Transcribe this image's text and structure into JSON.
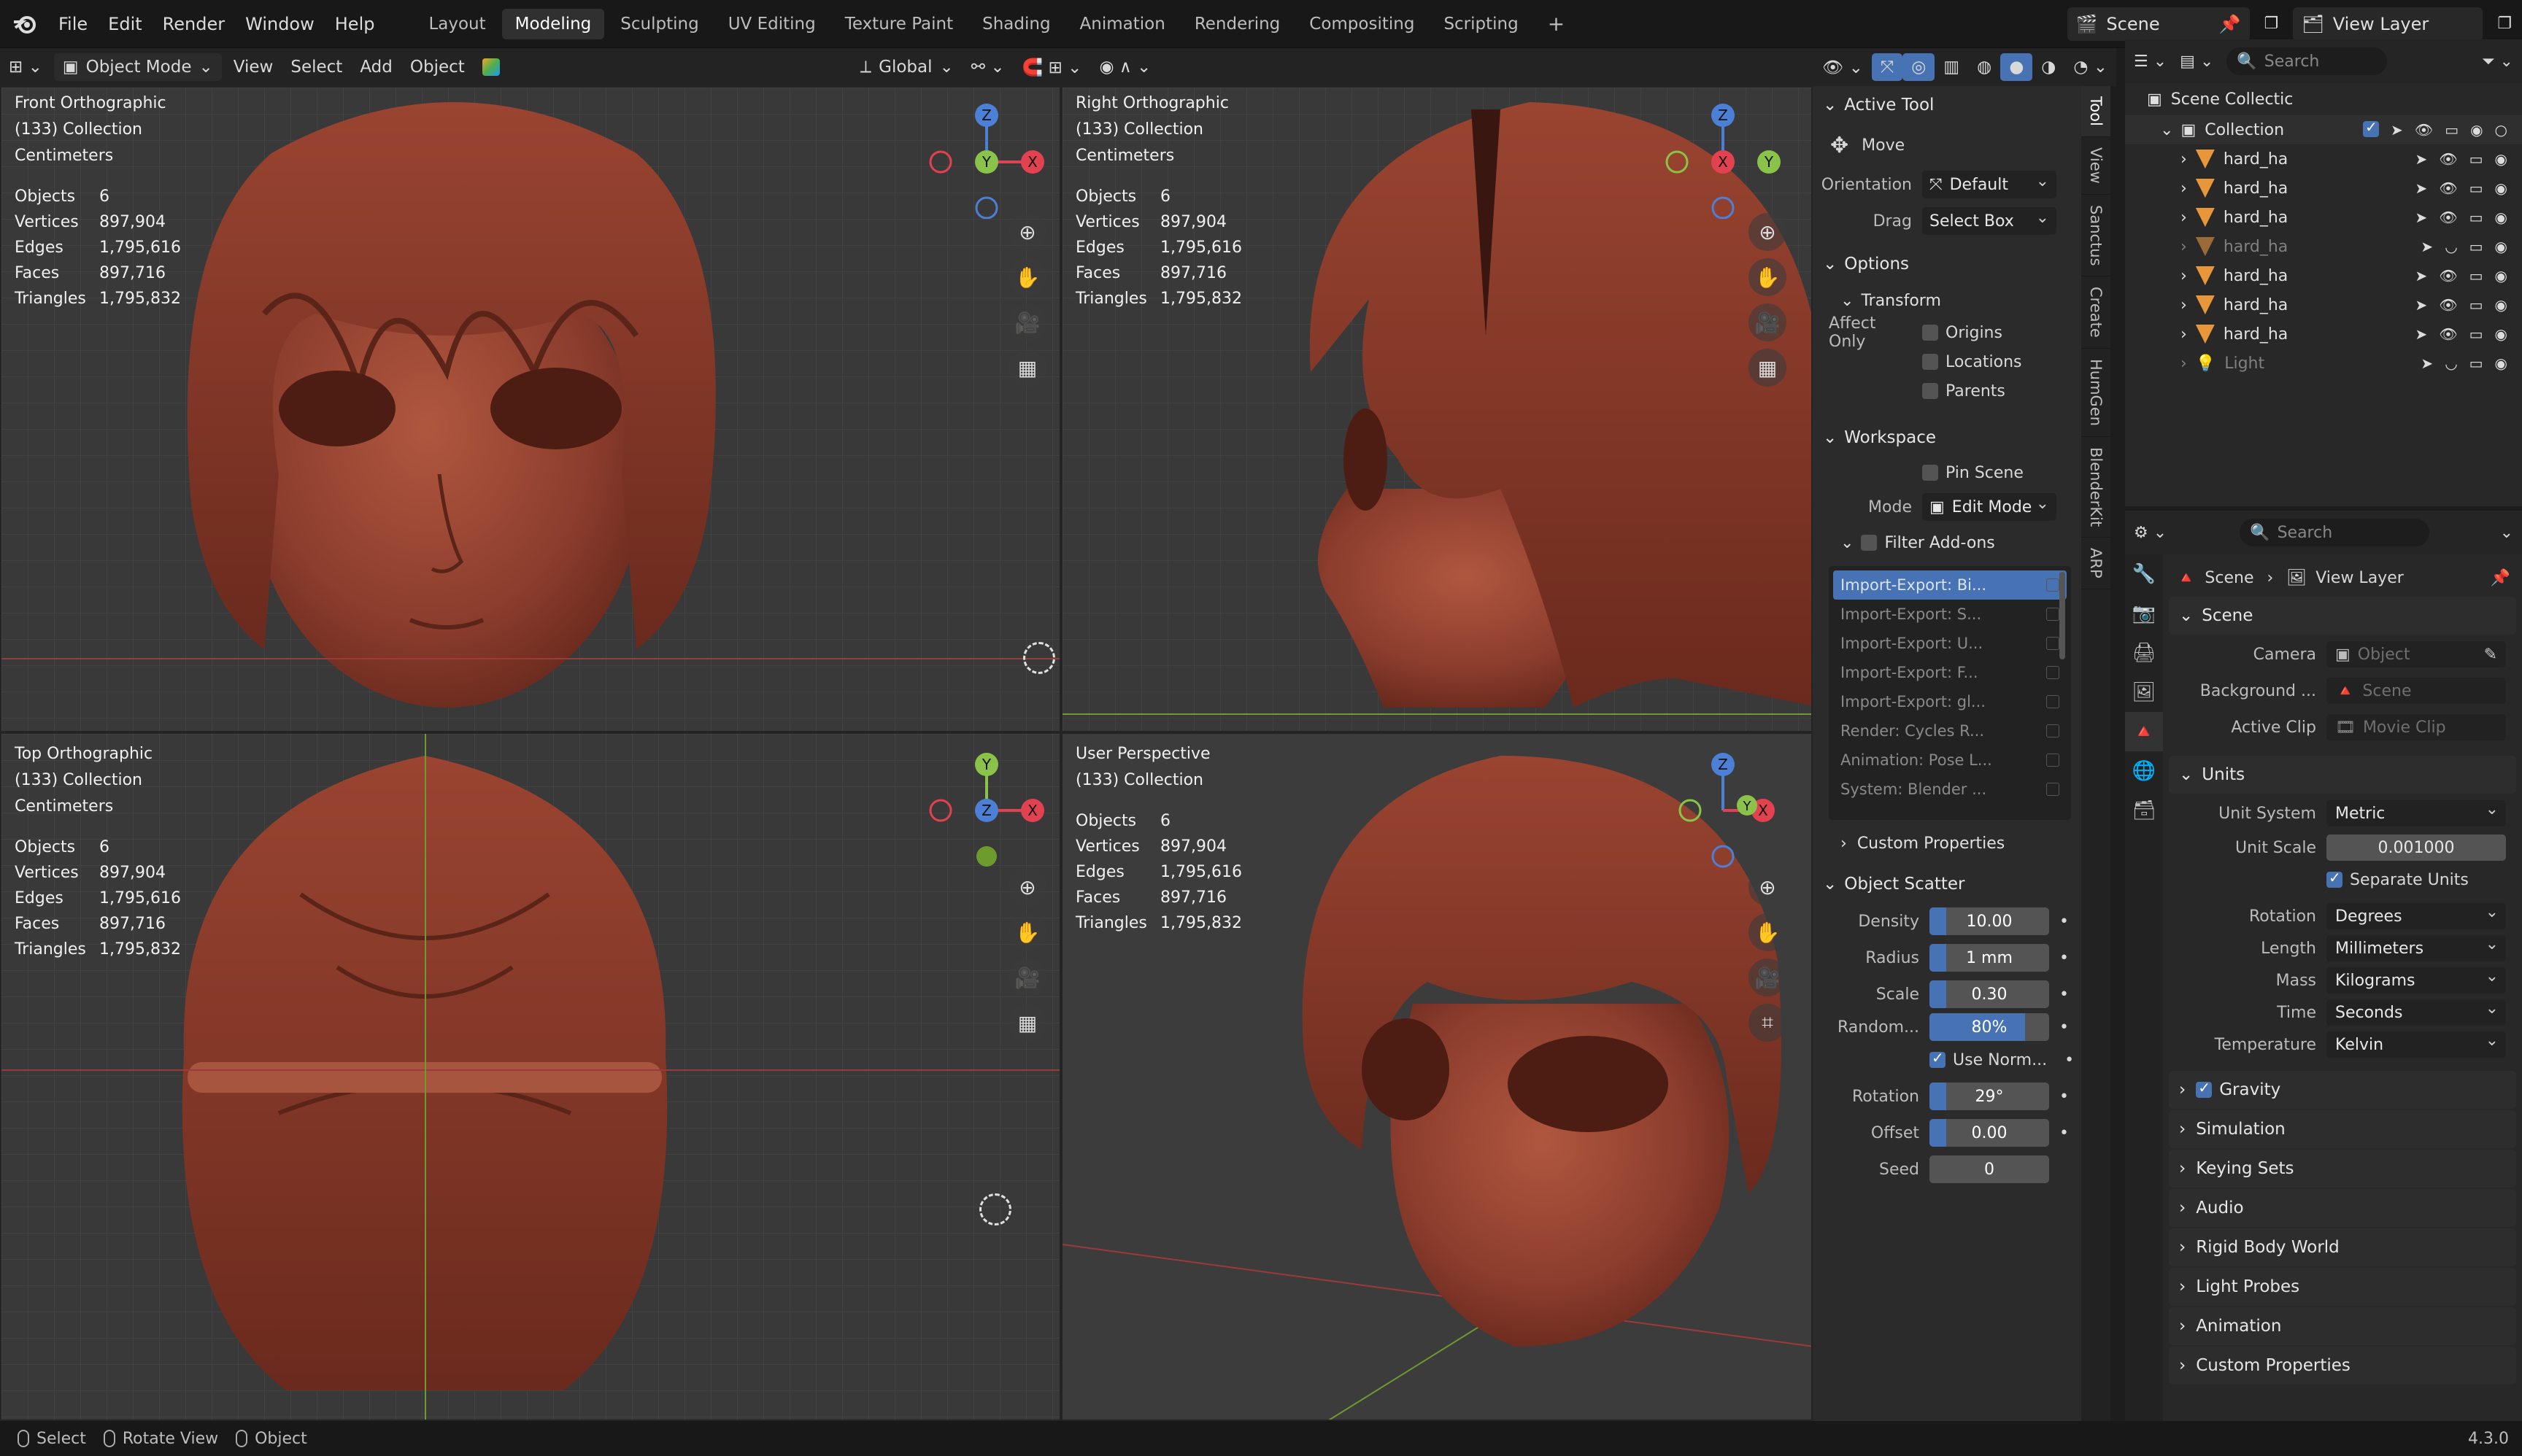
{
  "menu": [
    "File",
    "Edit",
    "Render",
    "Window",
    "Help"
  ],
  "workspaces": [
    "Layout",
    "Modeling",
    "Sculpting",
    "UV Editing",
    "Texture Paint",
    "Shading",
    "Animation",
    "Rendering",
    "Compositing",
    "Scripting"
  ],
  "active_workspace": "Modeling",
  "scene_name": "Scene",
  "view_layer": "View Layer",
  "viewport_header": {
    "mode": "Object Mode",
    "menus": [
      "View",
      "Select",
      "Add",
      "Object"
    ],
    "transform_orientation": "Global"
  },
  "viewports": {
    "front": {
      "title": "Front Orthographic",
      "collection": "(133) Collection",
      "units": "Centimeters"
    },
    "right": {
      "title": "Right Orthographic",
      "collection": "(133) Collection",
      "units": "Centimeters"
    },
    "top": {
      "title": "Top Orthographic",
      "collection": "(133) Collection",
      "units": "Centimeters"
    },
    "persp": {
      "title": "User Perspective",
      "collection": "(133) Collection"
    }
  },
  "stats": {
    "labels": [
      "Objects",
      "Vertices",
      "Edges",
      "Faces",
      "Triangles"
    ],
    "values": [
      "6",
      "897,904",
      "1,795,616",
      "897,716",
      "1,795,832"
    ]
  },
  "npanel": {
    "tabs": [
      "Tool",
      "View",
      "Sanctus",
      "Create",
      "HumGen",
      "BlenderKit",
      "ARP"
    ],
    "active_tool": {
      "header": "Active Tool",
      "name": "Move",
      "orientation_label": "Orientation",
      "orientation": "Default",
      "drag_label": "Drag",
      "drag": "Select Box"
    },
    "options": {
      "header": "Options",
      "transform": "Transform",
      "affect_only": "Affect Only",
      "origins": "Origins",
      "locations": "Locations",
      "parents": "Parents"
    },
    "workspace": {
      "header": "Workspace",
      "pin_scene": "Pin Scene",
      "mode_label": "Mode",
      "mode": "Edit Mode",
      "filter_addons": "Filter Add-ons",
      "addons": [
        "Import-Export: Bi...",
        "Import-Export: S...",
        "Import-Export: U...",
        "Import-Export: F...",
        "Import-Export: gl...",
        "Render: Cycles R...",
        "Animation: Pose L...",
        "System: Blender ..."
      ],
      "custom_props": "Custom Properties"
    },
    "object_scatter": {
      "header": "Object Scatter",
      "density_label": "Density",
      "density": "10.00",
      "radius_label": "Radius",
      "radius": "1 mm",
      "scale_label": "Scale",
      "scale": "0.30",
      "random_label": "Random...",
      "random": "80%",
      "use_normal": "Use Norm...",
      "rotation_label": "Rotation",
      "rotation": "29°",
      "offset_label": "Offset",
      "offset": "0.00",
      "seed_label": "Seed",
      "seed": "0"
    }
  },
  "outliner": {
    "search_placeholder": "Search",
    "root": "Scene Collectic",
    "collection": "Collection",
    "items": [
      "hard_ha",
      "hard_ha",
      "hard_ha",
      "hard_ha",
      "hard_ha",
      "hard_ha",
      "hard_ha",
      "Light"
    ]
  },
  "properties": {
    "search_placeholder": "Search",
    "breadcrumb_scene": "Scene",
    "breadcrumb_layer": "View Layer",
    "scene_section": "Scene",
    "camera_label": "Camera",
    "camera": "Object",
    "background_label": "Background ...",
    "background": "Scene",
    "active_clip_label": "Active Clip",
    "active_clip": "Movie Clip",
    "units_section": "Units",
    "unit_system_label": "Unit System",
    "unit_system": "Metric",
    "unit_scale_label": "Unit Scale",
    "unit_scale": "0.001000",
    "separate_units": "Separate Units",
    "rotation_label": "Rotation",
    "rotation": "Degrees",
    "length_label": "Length",
    "length": "Millimeters",
    "mass_label": "Mass",
    "mass": "Kilograms",
    "time_label": "Time",
    "time": "Seconds",
    "temperature_label": "Temperature",
    "temperature": "Kelvin",
    "collapsed": [
      "Gravity",
      "Simulation",
      "Keying Sets",
      "Audio",
      "Rigid Body World",
      "Light Probes",
      "Animation",
      "Custom Properties"
    ]
  },
  "statusbar": {
    "select": "Select",
    "rotate": "Rotate View",
    "object": "Object",
    "version": "4.3.0"
  },
  "colors": {
    "accent": "#4772b3",
    "axis_x": "#e2424f",
    "axis_y": "#8bc34a",
    "axis_z": "#4c7fd6",
    "mesh": "#8a3a2e"
  }
}
